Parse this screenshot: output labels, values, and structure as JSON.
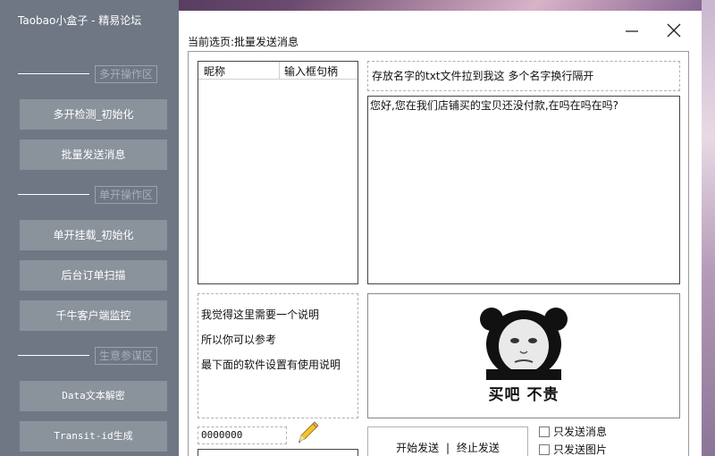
{
  "app": {
    "title": "Taobao小盒子 - 精易论坛"
  },
  "sidebar": {
    "sections": [
      {
        "label": "多开操作区"
      },
      {
        "label": "单开操作区"
      },
      {
        "label": "生意参谋区"
      }
    ],
    "buttons": [
      {
        "label": "多开检测_初始化"
      },
      {
        "label": "批量发送消息"
      },
      {
        "label": "单开挂载_初始化"
      },
      {
        "label": "后台订单扫描"
      },
      {
        "label": "千牛客户端监控"
      },
      {
        "label": "Data文本解密"
      },
      {
        "label": "Transit-id生成"
      }
    ]
  },
  "main": {
    "current_page": "当前选页:批量发送消息",
    "table": {
      "columns": [
        "昵称",
        "输入框句柄"
      ]
    },
    "hint": "存放名字的txt文件拉到我这 多个名字换行隔开",
    "message": "您好,您在我们店铺买的宝贝还没付款,在吗在吗在吗?",
    "notes": [
      "我觉得这里需要一个说明",
      "所以你可以参考",
      "最下面的软件设置有使用说明"
    ],
    "meme_caption": "买吧 不贵",
    "code_value": "0000000",
    "send": {
      "start": "开始发送",
      "separator": "|",
      "stop": "终止发送"
    },
    "options": [
      {
        "label": "只发送消息",
        "checked": false
      },
      {
        "label": "只发送图片",
        "checked": false
      }
    ]
  }
}
